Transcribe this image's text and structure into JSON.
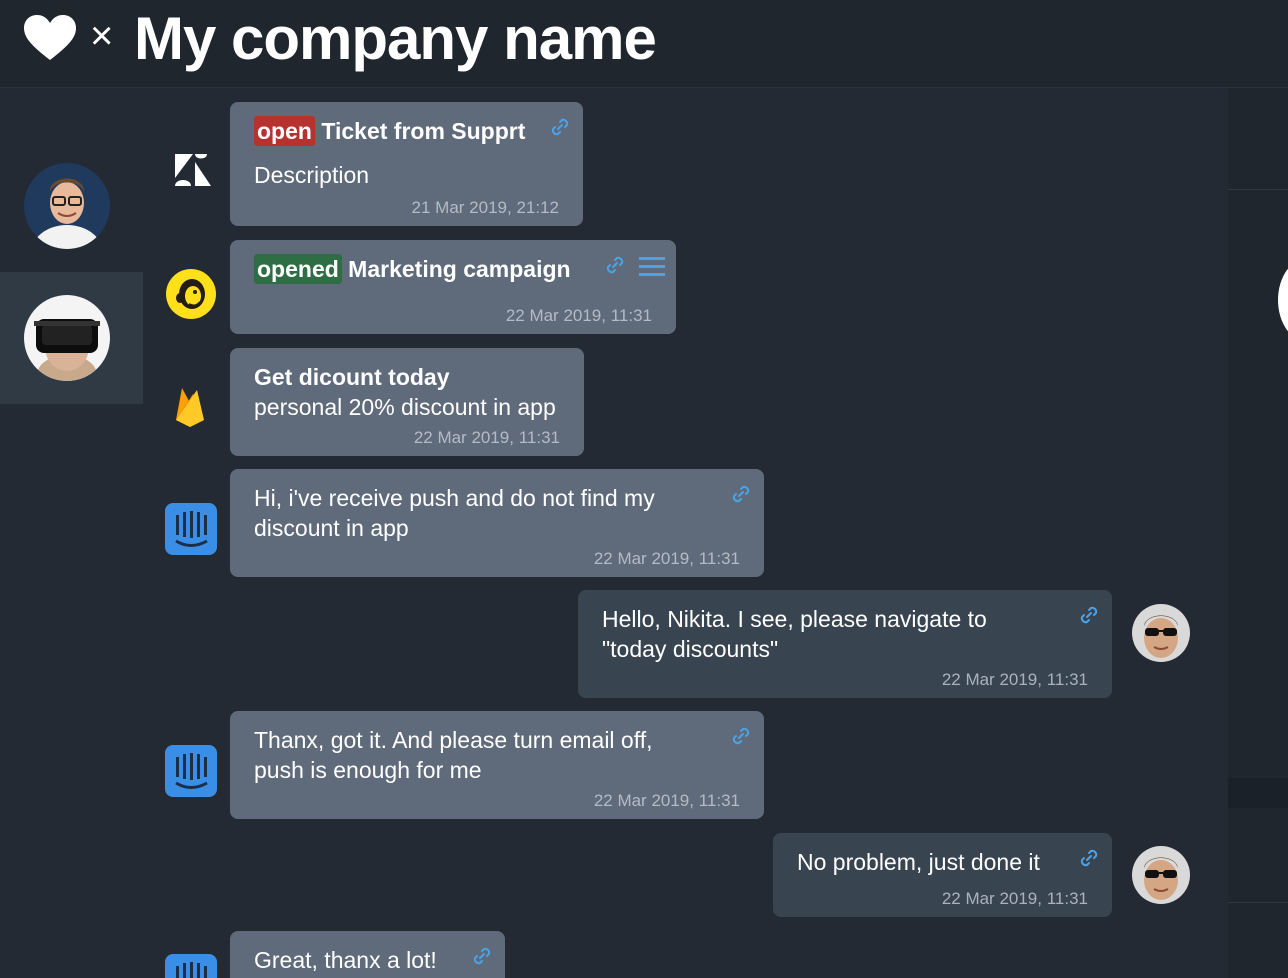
{
  "header": {
    "times": "×",
    "company_name": "My company name"
  },
  "messages": [
    {
      "tag": "open",
      "title": "Ticket from Supprt",
      "text": "Description",
      "time": "21 Mar 2019, 21:12",
      "source": "zendesk-icon"
    },
    {
      "tag": "opened",
      "title": "Marketing campaign",
      "text": "",
      "time": "22 Mar 2019, 11:31",
      "source": "mailchimp-icon"
    },
    {
      "title": "Get dicount today",
      "text": "personal 20% discount in app",
      "time": "22 Mar 2019, 11:31",
      "source": "firebase-icon"
    },
    {
      "text": "Hi, i've receive push and do not find my discount in app",
      "time": "22 Mar 2019, 11:31",
      "source": "intercom-icon"
    },
    {
      "text": "Hello, Nikita. I see, please navigate to \"today discounts\"",
      "time": "22 Mar 2019, 11:31",
      "direction": "outgoing"
    },
    {
      "text": "Thanx, got it. And please turn email off, push is enough for me",
      "time": "22 Mar 2019, 11:31",
      "source": "intercom-icon"
    },
    {
      "text": "No problem, just done it",
      "time": "22 Mar 2019, 11:31",
      "direction": "outgoing"
    },
    {
      "text": "Great, thanx a lot!",
      "source": "intercom-icon"
    }
  ],
  "colors": {
    "background": "#232a33",
    "incoming_bubble": "#5f6b7a",
    "outgoing_bubble": "#394451",
    "open_tag": "#b5322e",
    "opened_tag": "#2f6e44",
    "link": "#4aa3e8"
  }
}
